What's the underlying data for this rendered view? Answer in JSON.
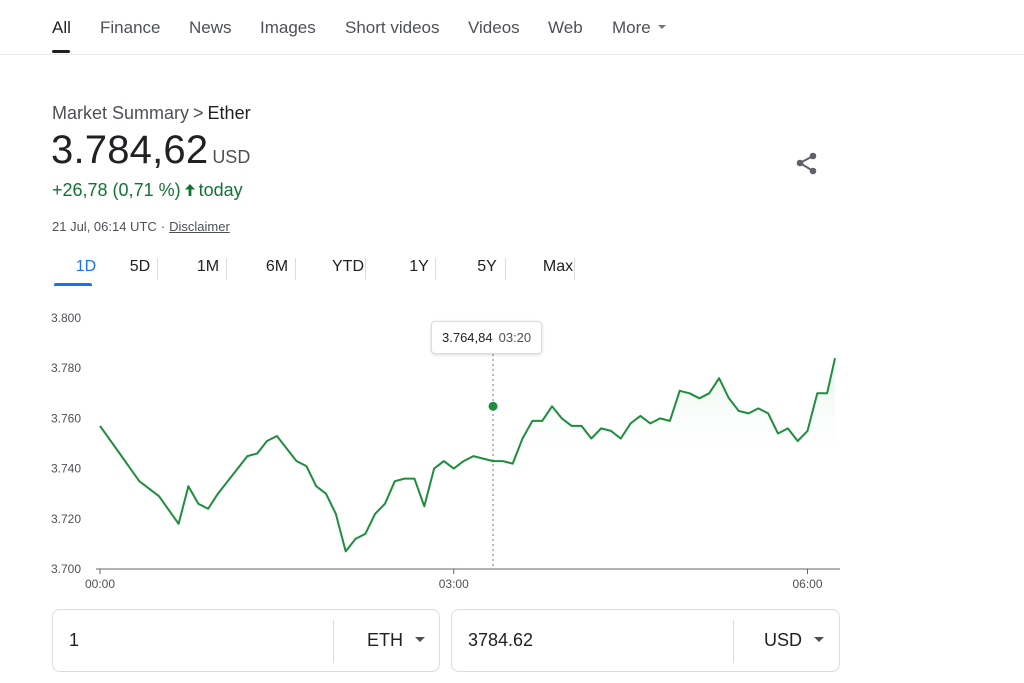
{
  "nav": {
    "tabs": [
      {
        "label": "All"
      },
      {
        "label": "Finance"
      },
      {
        "label": "News"
      },
      {
        "label": "Images"
      },
      {
        "label": "Short videos"
      },
      {
        "label": "Videos"
      },
      {
        "label": "Web"
      },
      {
        "label": "More"
      }
    ],
    "active": "All"
  },
  "summary": {
    "breadcrumb_parent": "Market Summary",
    "breadcrumb_sep": ">",
    "breadcrumb_current": "Ether",
    "price": "3.784,62",
    "currency": "USD",
    "change": "+26,78 (0,71 %)",
    "change_arrow": "🡑",
    "change_period": "today",
    "timestamp": "21 Jul, 06:14 UTC",
    "timestamp_sep": "·",
    "disclaimer": "Disclaimer",
    "share_icon": "share-icon"
  },
  "ranges": {
    "items": [
      "1D",
      "5D",
      "1M",
      "6M",
      "YTD",
      "1Y",
      "5Y",
      "Max"
    ],
    "active": "1D"
  },
  "tooltip": {
    "value": "3.764,84",
    "time": "03:20"
  },
  "chart_data": {
    "type": "line",
    "title": "",
    "xlabel": "",
    "ylabel": "",
    "ylim": [
      3700,
      3800
    ],
    "y_ticks": [
      "3.800",
      "3.780",
      "3.760",
      "3.740",
      "3.720",
      "3.700"
    ],
    "y_tick_values": [
      3800,
      3780,
      3760,
      3740,
      3720,
      3700
    ],
    "x_ticks": [
      "00:00",
      "03:00",
      "06:00"
    ],
    "x_tick_minutes": [
      0,
      180,
      360
    ],
    "x_range_minutes": [
      0,
      374
    ],
    "grid": false,
    "colors": {
      "line": "#1e8e3e",
      "fill_start": "#e6f4ea",
      "crosshair": "#70757a"
    },
    "highlight": {
      "minutes": 200,
      "value": 3764.84
    },
    "series": [
      {
        "minutes": [
          0,
          10,
          20,
          30,
          40,
          45,
          50,
          55,
          60,
          65,
          75,
          80,
          85,
          90,
          100,
          105,
          110,
          115,
          120,
          125,
          130,
          135,
          140,
          145,
          150,
          155,
          160,
          165,
          170,
          175,
          180,
          185,
          190,
          195,
          200,
          205,
          210,
          215,
          220,
          225,
          230,
          235,
          240,
          245,
          250,
          255,
          260,
          265,
          270,
          275,
          280,
          285,
          290,
          295,
          300,
          305,
          310,
          315,
          320,
          325,
          330,
          335,
          340,
          345,
          350,
          355,
          360,
          365,
          370,
          374
        ],
        "values": [
          3757,
          3746,
          3735,
          3729,
          3718,
          3733,
          3726,
          3724,
          3730,
          3735,
          3745,
          3746,
          3751,
          3753,
          3743,
          3741,
          3733,
          3730,
          3722,
          3707,
          3712,
          3714,
          3722,
          3726,
          3735,
          3736,
          3736,
          3725,
          3740,
          3743,
          3740,
          3743,
          3745,
          3744,
          3743,
          3743,
          3742,
          3752,
          3759,
          3759,
          3764.84,
          3760,
          3757,
          3757,
          3752,
          3756,
          3755,
          3752,
          3758,
          3761,
          3758,
          3760,
          3759,
          3771,
          3770,
          3768,
          3770,
          3776,
          3768,
          3763,
          3762,
          3764,
          3762,
          3754,
          3756,
          3751,
          3755,
          3770,
          3770,
          3784
        ]
      }
    ]
  },
  "converter": {
    "from_amount": "1",
    "from_unit": "ETH",
    "to_amount": "3784.62",
    "to_unit": "USD"
  }
}
